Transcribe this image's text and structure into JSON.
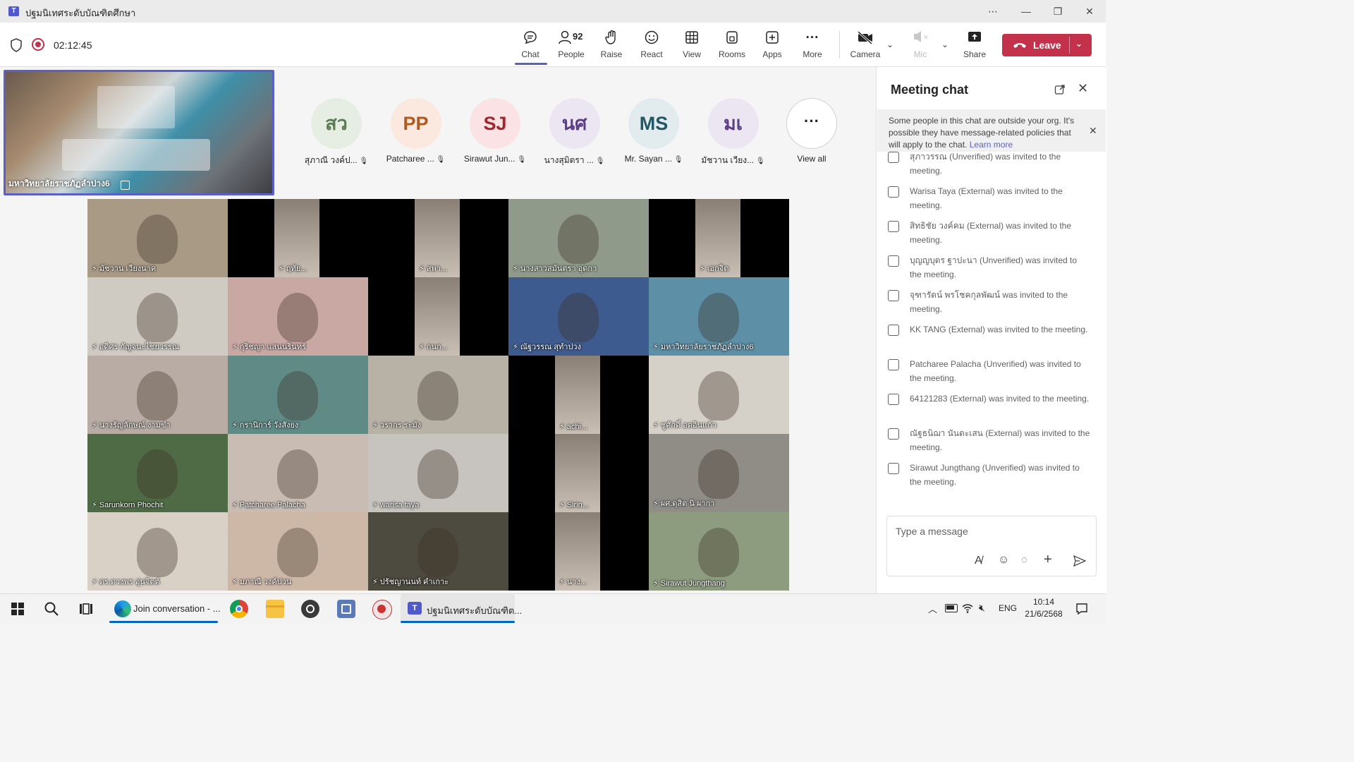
{
  "window": {
    "title": "ปฐมนิเทศระดับบัณฑิตศึกษา",
    "controls": [
      "more-icon",
      "minimize-icon",
      "restore-icon",
      "close-icon"
    ]
  },
  "meeting": {
    "timer": "02:12:45"
  },
  "toolbar": {
    "chat": "Chat",
    "people": "People",
    "people_count": "92",
    "raise": "Raise",
    "react": "React",
    "view": "View",
    "rooms": "Rooms",
    "apps": "Apps",
    "more": "More",
    "camera": "Camera",
    "mic": "Mic",
    "share": "Share",
    "leave": "Leave"
  },
  "pinned": {
    "name": "มหาวิทยาลัยราชภัฏลำปาง6"
  },
  "avatars": [
    {
      "initials": "สว",
      "name": "สุภาณี วงค์ป...",
      "bg": "#e6ede2",
      "fg": "#5c7a52"
    },
    {
      "initials": "PP",
      "name": "Patcharee ...",
      "bg": "#fbe9df",
      "fg": "#b15a1d"
    },
    {
      "initials": "SJ",
      "name": "Sirawut Jun...",
      "bg": "#fbe3e5",
      "fg": "#a4262c"
    },
    {
      "initials": "นศ",
      "name": "นางสุมิตรา ...",
      "bg": "#ece6f2",
      "fg": "#5c3d87"
    },
    {
      "initials": "MS",
      "name": "Mr. Sayan ...",
      "bg": "#e2ecee",
      "fg": "#215863"
    },
    {
      "initials": "มเ",
      "name": "มัชวาน เวียง...",
      "bg": "#ece6f2",
      "fg": "#5c3d87"
    }
  ],
  "view_all": "View all",
  "grid": [
    {
      "name": "มัชวาน เวียงนาค",
      "bg": "#a89a85"
    },
    {
      "name": "ฤทัย...",
      "bg": "#000000"
    },
    {
      "name": "สพา...",
      "bg": "#000000"
    },
    {
      "name": "นางสาวสมันตรา อุดกา",
      "bg": "#8f9a8a"
    },
    {
      "name": "เอกจิต",
      "bg": "#000000"
    },
    {
      "name": "อดิศร กัญจนะไชยวรรณ",
      "bg": "#cfcac2"
    },
    {
      "name": "กุริชญา แสนนรินทร์",
      "bg": "#c9a8a3"
    },
    {
      "name": "กนก...",
      "bg": "#000000"
    },
    {
      "name": "ณัฐวรรณ สุทำปวง",
      "bg": "#3e5b8f"
    },
    {
      "name": "มหาวิทยาลัยราชภัฏลำปาง6",
      "bg": "#5d8fa6"
    },
    {
      "name": "นางรัญลักษณ์ งามขำ",
      "bg": "#b8aca4"
    },
    {
      "name": "กรานิการ์ วังสังยง",
      "bg": "#5f8a86"
    },
    {
      "name": "วรากร ระมัง",
      "bg": "#b7b1a6"
    },
    {
      "name": "achi...",
      "bg": "#000000"
    },
    {
      "name": "ชูศักดิ์ อดอินแก้ว",
      "bg": "#d6d1c8"
    },
    {
      "name": "Sarunkorn Phochit",
      "bg": "#4f6b45"
    },
    {
      "name": "Patcharee Palacha",
      "bg": "#c8bcb3"
    },
    {
      "name": "warisa taya",
      "bg": "#c7c4bf"
    },
    {
      "name": "Sirin...",
      "bg": "#000000"
    },
    {
      "name": "ผศ.ดุสิต นิ ผากา",
      "bg": "#8f8d86"
    },
    {
      "name": "ดร.ดวงพร อุ่นจิตต์",
      "bg": "#d9d0c6"
    },
    {
      "name": "มภาณี วงค์ปวน",
      "bg": "#cdb8a8"
    },
    {
      "name": "ปรัชญานนท์ คำเกาะ",
      "bg": "#4d4a3f"
    },
    {
      "name": "นาง...",
      "bg": "#000000"
    },
    {
      "name": "Sirawut Jungthang",
      "bg": "#8d9b7f"
    }
  ],
  "chat": {
    "title": "Meeting chat",
    "notice": "Some people in this chat are outside your org. It's possible they have message-related policies that will apply to the chat.",
    "notice_link": "Learn more",
    "messages": [
      "สุภาวรรณ (Unverified) was invited to the meeting.",
      "Warisa Taya (External) was invited to the meeting.",
      "สิทธิชัย วงค์คม (External) was invited to the meeting.",
      "บุญญบุตร ฐาปะนา (Unverified) was invited to the meeting.",
      "จุฑารัตน์ พรโชคกุลพัฒน์ was invited to the meeting.",
      "KK TANG (External) was invited to the meeting.",
      "Patcharee Palacha (Unverified) was invited to the meeting.",
      "64121283 (External) was invited to the meeting.",
      "ณัฐธนิฌา นันตะเสน (External) was invited to the meeting.",
      "Sirawut Jungthang (Unverified) was invited to the meeting."
    ],
    "compose_placeholder": "Type a message"
  },
  "taskbar": {
    "edge_label": "Join conversation - ...",
    "teams_label": "ปฐมนิเทศระดับบัณฑิต...",
    "lang": "ENG",
    "time": "10:14",
    "date": "21/6/2568"
  },
  "colors": {
    "accent": "#5b5fc7",
    "leave": "#c4314b",
    "record": "#c4314b"
  }
}
